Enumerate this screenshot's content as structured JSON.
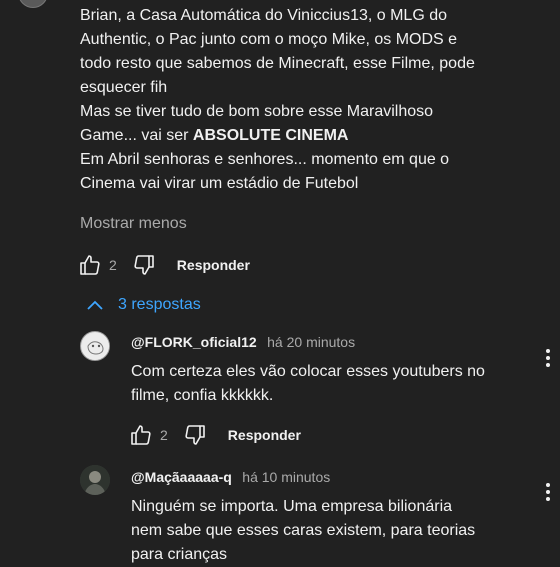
{
  "main_comment": {
    "lines": [
      "Brian, a Casa Automática do Viniccius13, o MLG do",
      "Authentic, o Pac junto com o moço Mike, os MODS e",
      "todo resto que sabemos de Minecraft, esse Filme, pode",
      "esquecer fih",
      "Mas se tiver tudo de bom sobre esse Maravilhoso",
      "Game... vai ser ",
      "ABSOLUTE CINEMA",
      "Em Abril senhoras e senhores... momento em que o",
      "Cinema vai virar um estádio de Futebol"
    ],
    "show_less": "Mostrar menos",
    "like_count": "2",
    "reply_label": "Responder"
  },
  "replies_toggle": {
    "label": "3 respostas"
  },
  "replies": [
    {
      "author": "@FLORK_oficial12",
      "time": "há 20 minutos",
      "lines": [
        "Com certeza eles vão colocar esses youtubers no",
        "filme, confia kkkkkk."
      ],
      "like_count": "2",
      "reply_label": "Responder"
    },
    {
      "author": "@Maçãaaaaa-q",
      "time": "há 10 minutos",
      "lines": [
        "Ninguém se importa. Uma empresa bilionária",
        "nem sabe que esses caras existem, para teorias",
        "para crianças"
      ]
    }
  ],
  "colors": {
    "background": "#212121",
    "text": "#f1f1f1",
    "muted": "#aaaaaa",
    "link": "#3ea6ff"
  }
}
